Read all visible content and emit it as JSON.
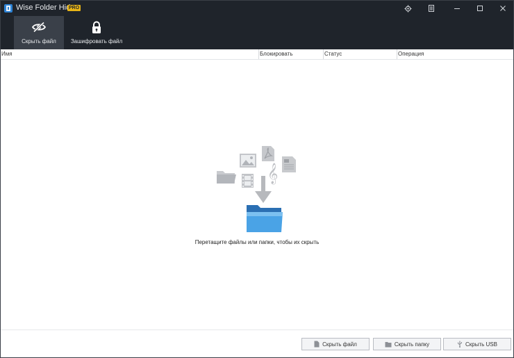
{
  "app": {
    "title": "Wise Folder Hider",
    "badge": "PRO"
  },
  "titlebar": {
    "icons": [
      "settings-icon",
      "menu-icon",
      "minimize-icon",
      "maximize-icon",
      "close-icon"
    ]
  },
  "toolbar": {
    "hide_file_label": "Скрыть файл",
    "encrypt_file_label": "Зашифровать файл"
  },
  "table": {
    "columns": [
      "Имя",
      "Блокировать",
      "Статус",
      "Операция"
    ]
  },
  "empty_state": {
    "message": "Перетащите файлы или папки, чтобы их скрыть",
    "icons": [
      "folder-icon",
      "image-icon",
      "pdf-icon",
      "music-icon",
      "video-icon",
      "document-icon",
      "arrow-down-icon",
      "blue-folder-icon"
    ]
  },
  "footer": {
    "hide_file": "Скрыть файл",
    "hide_folder": "Скрыть папку",
    "hide_usb": "Скрыть USB"
  },
  "colors": {
    "dark_bg": "#1f242b",
    "active_tab": "#3a4049",
    "accent_folder": "#3a8fd8"
  }
}
